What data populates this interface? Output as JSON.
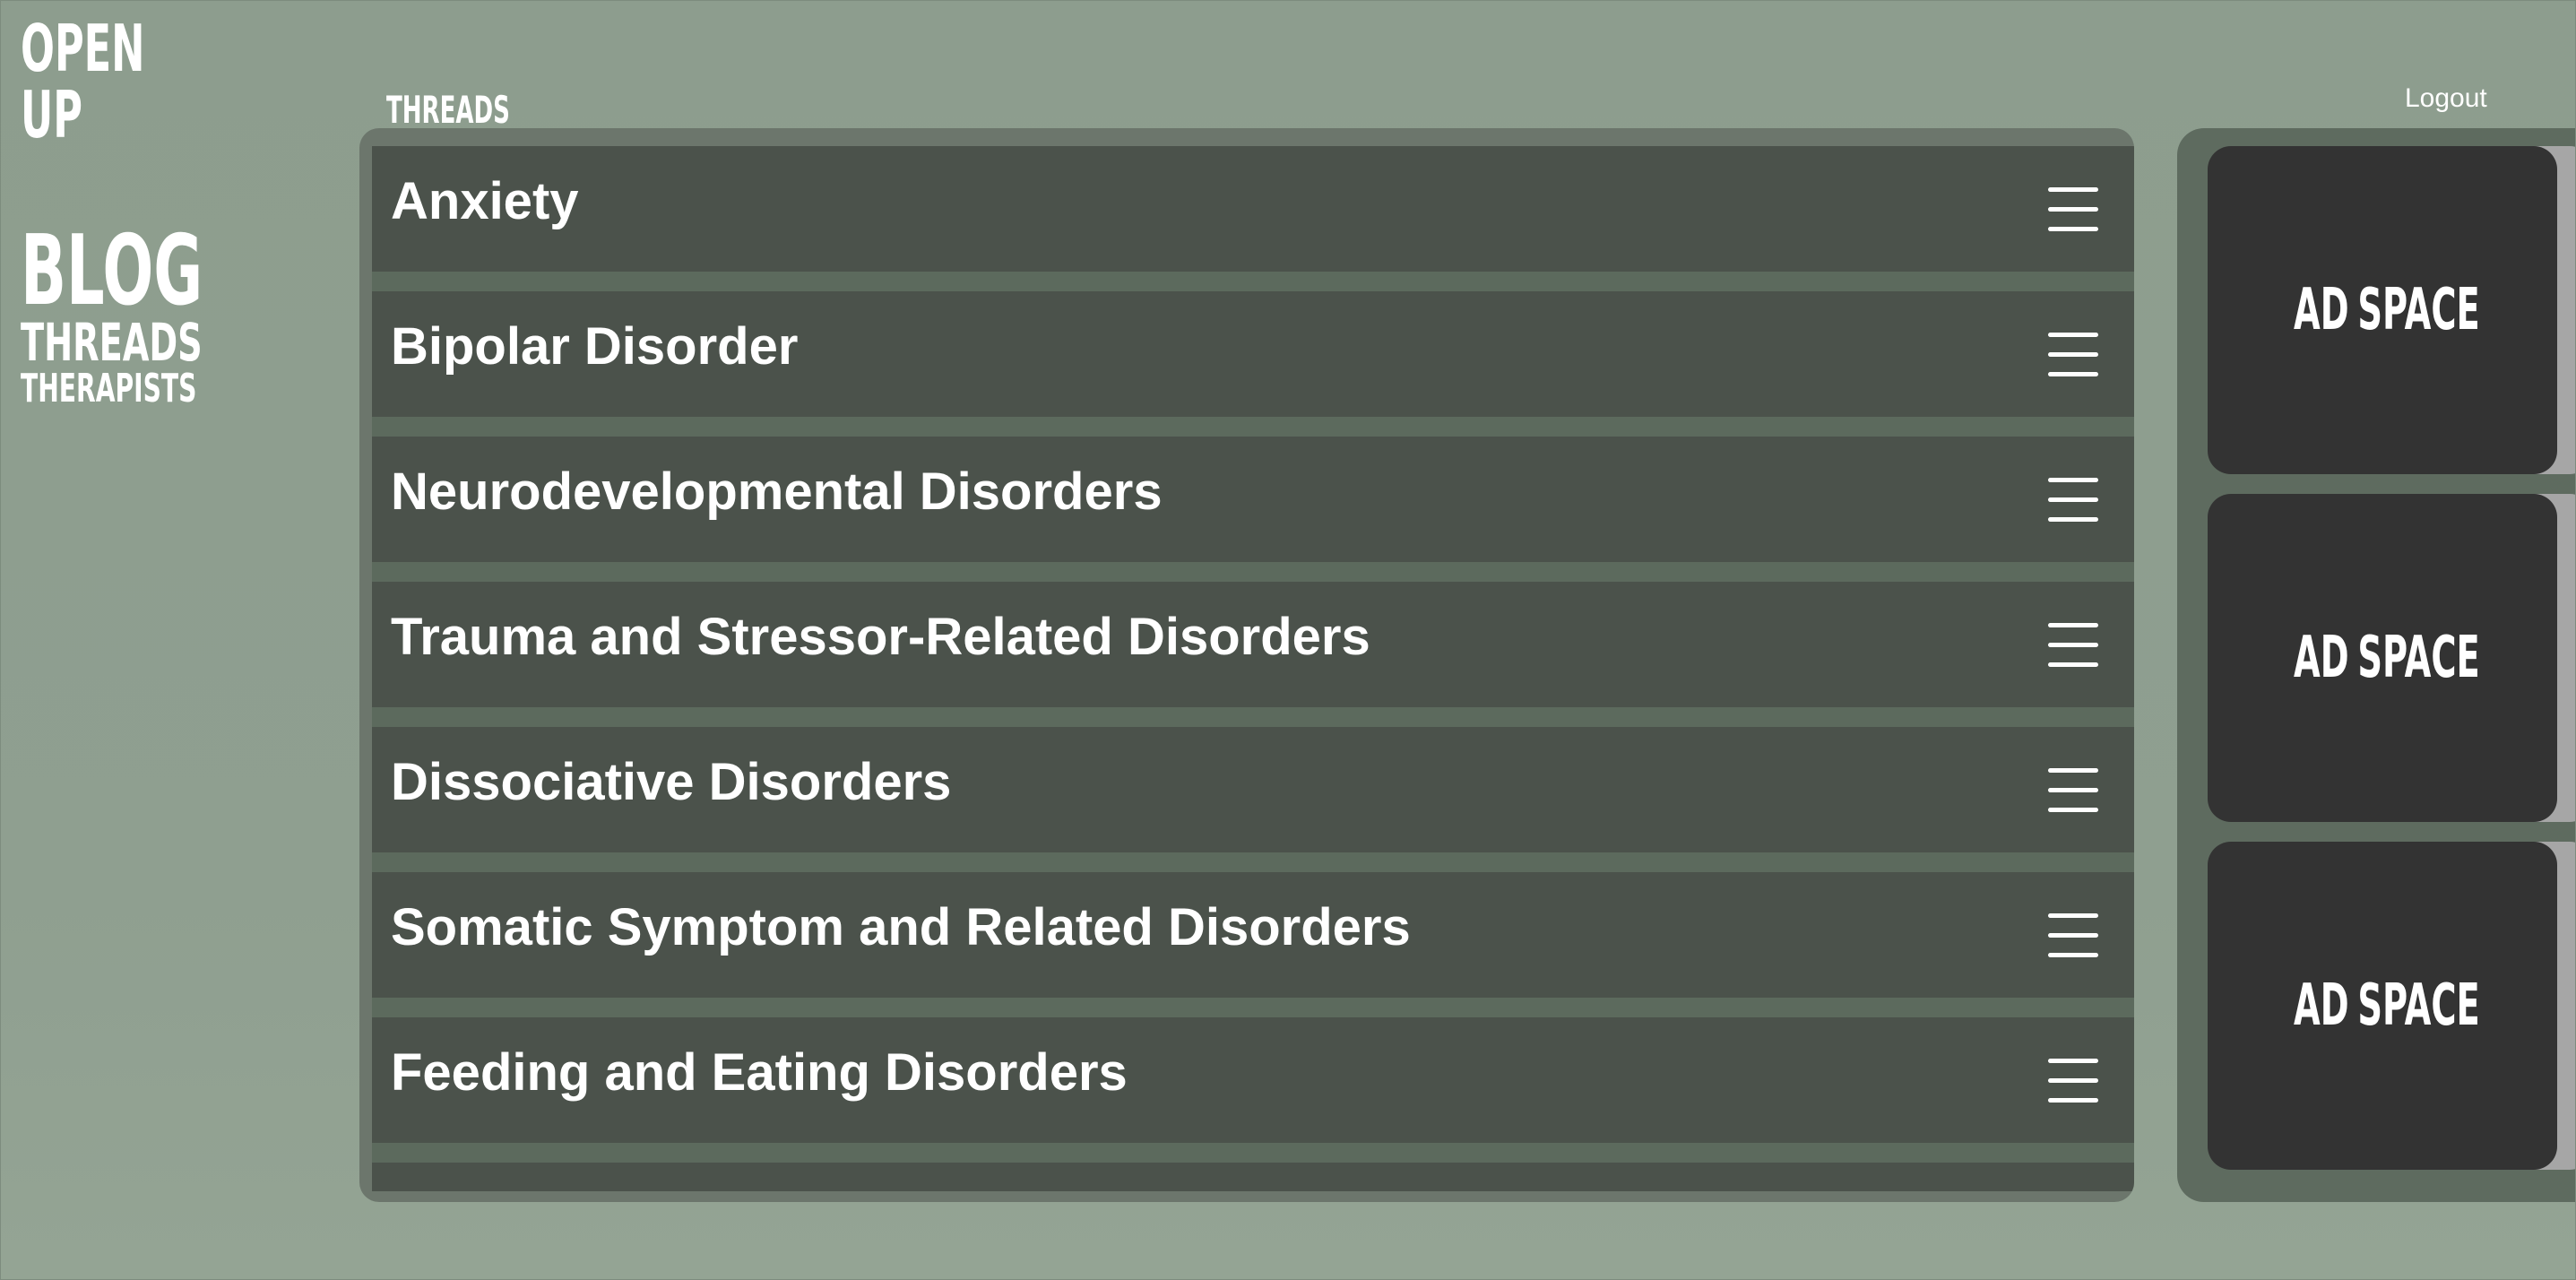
{
  "brand": {
    "line1": "OPEN",
    "line2": "UP"
  },
  "nav": {
    "blog": "BLOG",
    "threads": "THREADS",
    "therapists": "THERAPISTS"
  },
  "header": {
    "threads_heading": "THREADS",
    "logout": "Logout"
  },
  "threads": [
    {
      "title": "Anxiety",
      "menu_icon": "hamburger-menu-icon"
    },
    {
      "title": "Bipolar Disorder",
      "menu_icon": "hamburger-menu-icon"
    },
    {
      "title": "Neurodevelopmental Disorders",
      "menu_icon": "hamburger-menu-icon"
    },
    {
      "title": "Trauma and Stressor-Related Disorders",
      "menu_icon": "hamburger-menu-icon"
    },
    {
      "title": "Dissociative Disorders",
      "menu_icon": "hamburger-menu-icon"
    },
    {
      "title": "Somatic Symptom and Related Disorders",
      "menu_icon": "hamburger-menu-icon"
    },
    {
      "title": "Feeding and Eating Disorders",
      "menu_icon": "hamburger-menu-icon"
    },
    {
      "title": "",
      "menu_icon": "hamburger-menu-icon"
    }
  ],
  "ads": [
    {
      "label": "AD SPACE"
    },
    {
      "label": "AD SPACE"
    },
    {
      "label": "AD SPACE"
    }
  ],
  "colors": {
    "page_background": "#8e9e8f",
    "panel_background": "#6c766c",
    "thread_row": "#4b524b",
    "row_separator": "#5c6a5d",
    "ad_background": "#333333",
    "ad_shadow": "#a6a6a6",
    "text": "#ffffff"
  }
}
